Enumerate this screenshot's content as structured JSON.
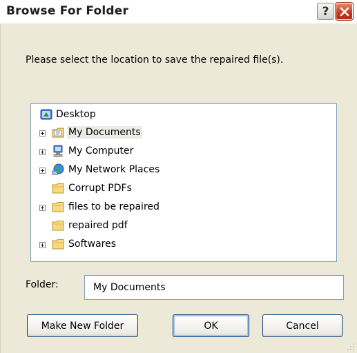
{
  "window": {
    "title": "Browse For Folder",
    "help_label": "?",
    "prompt": "Please select the location to save the repaired file(s)."
  },
  "tree": {
    "items": [
      {
        "label": "Desktop",
        "icon": "desktop-icon",
        "expandable": false
      },
      {
        "label": "My Documents",
        "icon": "my-documents-icon",
        "expandable": true,
        "selected": true
      },
      {
        "label": "My Computer",
        "icon": "my-computer-icon",
        "expandable": true
      },
      {
        "label": "My Network Places",
        "icon": "network-places-icon",
        "expandable": true
      },
      {
        "label": "Corrupt PDFs",
        "icon": "folder-icon",
        "expandable": false
      },
      {
        "label": "files to be repaired",
        "icon": "folder-icon",
        "expandable": true
      },
      {
        "label": "repaired pdf",
        "icon": "folder-icon",
        "expandable": false
      },
      {
        "label": "Softwares",
        "icon": "folder-icon",
        "expandable": true
      }
    ]
  },
  "folder": {
    "label": "Folder:",
    "value": "My Documents"
  },
  "buttons": {
    "make_new_folder": "Make New Folder",
    "ok": "OK",
    "cancel": "Cancel"
  },
  "colors": {
    "dialog_face": "#ece9d8",
    "close_button": "#c3391b",
    "field_border": "#7f9db9"
  }
}
